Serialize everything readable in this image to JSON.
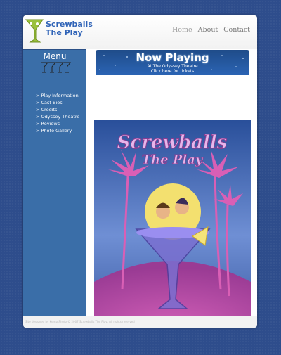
{
  "brand": {
    "line1": "Screwballs",
    "line2": "The Play"
  },
  "nav": {
    "items": [
      "Home",
      "About",
      "Contact"
    ]
  },
  "sidebar": {
    "title": "Menu",
    "items": [
      "> Play Information",
      "> Cast Bios",
      "> Credits",
      "> Odyssey Theatre",
      "> Reviews",
      "> Photo Gallery"
    ]
  },
  "banner": {
    "title": "Now Playing",
    "line1": "At The Odyssey Theatre",
    "line2": "Click here for tickets"
  },
  "poster": {
    "title1": "Screwballs",
    "title2": "The Play"
  },
  "footer": {
    "text": "Site designed by KemptPhoto © 2007 Screwballs The Play, All rights reserved"
  },
  "colors": {
    "page_background": "#2e4d8c",
    "sidebar": "#3a6ea8",
    "brand_blue": "#2f63b7",
    "poster_purple": "#b44ea8"
  }
}
